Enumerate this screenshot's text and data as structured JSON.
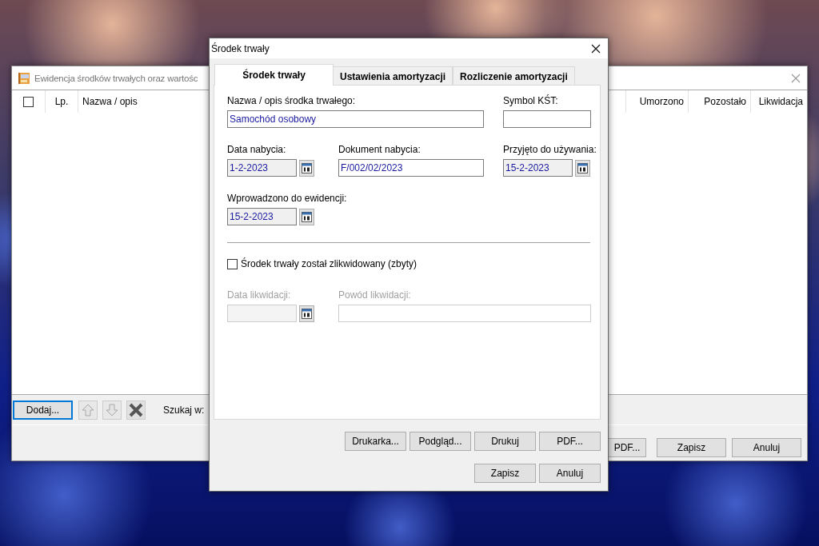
{
  "back_window": {
    "title": "Ewidencja środków trwałych oraz wartośc",
    "columns": [
      {
        "kind": "checkbox",
        "checked": false
      },
      {
        "kind": "text",
        "label": "Lp."
      },
      {
        "kind": "text",
        "label": "Nazwa / opis"
      },
      {
        "kind": "text",
        "label": "Umorzono"
      },
      {
        "kind": "text",
        "label": "Pozostało"
      },
      {
        "kind": "text",
        "label": "Likwidacja"
      }
    ],
    "add_button": {
      "label": "Dodaj...",
      "focused": true
    },
    "icon_buttons": [
      {
        "kind": "up",
        "disabled": true
      },
      {
        "kind": "down",
        "disabled": true
      },
      {
        "kind": "delete",
        "disabled": false
      }
    ],
    "search_label": "Szukaj w:",
    "buttons": [
      "PDF...",
      "Zapisz",
      "Anuluj"
    ]
  },
  "dialog": {
    "title": "Środek trwały",
    "tabs": [
      {
        "label": "Środek trwały",
        "selected": true
      },
      {
        "label": "Ustawienia amortyzacji",
        "selected": false
      },
      {
        "label": "Rozliczenie amortyzacji",
        "selected": false
      }
    ],
    "field_rows": [
      [
        {
          "label": "Nazwa / opis środka trwałego:",
          "kind": "text",
          "value": "Samochód osobowy",
          "disabled": false
        },
        {
          "label": "Symbol KŚT:",
          "kind": "text",
          "disabled": false
        }
      ],
      [
        {
          "label": "Data nabycia:",
          "kind": "date",
          "value": "1-2-2023",
          "disabled": false
        },
        {
          "label": "Dokument nabycia:",
          "kind": "text",
          "value": "F/002/02/2023",
          "disabled": false
        },
        {
          "label": "Przyjęto do używania:",
          "kind": "date",
          "value": "15-2-2023",
          "disabled": false
        }
      ],
      [
        {
          "label": "Wprowadzono do ewidencji:",
          "kind": "date",
          "value": "15-2-2023",
          "disabled": false
        }
      ]
    ],
    "liquidated": {
      "label": "Środek trwały został zlikwidowany (zbyty)",
      "checked": false
    },
    "liquidation_fields": [
      {
        "label": "Data likwidacji:",
        "kind": "date",
        "disabled": true
      },
      {
        "label": "Powód likwidacji:",
        "kind": "text",
        "disabled": true
      }
    ],
    "print_buttons": [
      "Drukarka...",
      "Podgląd...",
      "Drukuj",
      "PDF..."
    ],
    "buttons": [
      "Zapisz",
      "Anuluj"
    ]
  }
}
